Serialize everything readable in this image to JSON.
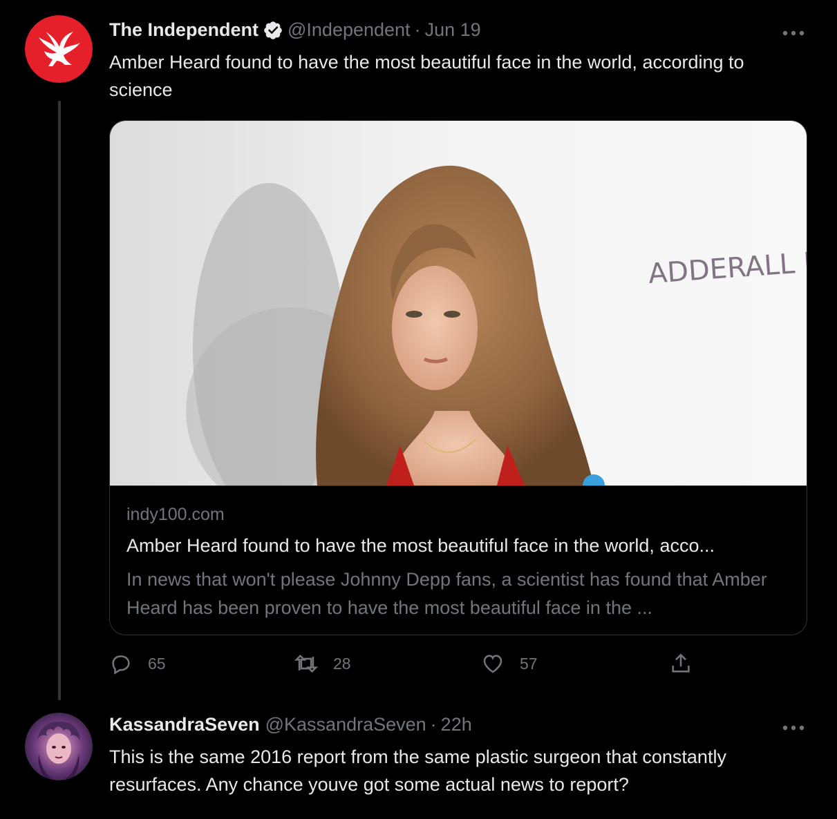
{
  "tweet": {
    "author": "The Independent",
    "handle": "@Independent",
    "separator": "·",
    "time": "Jun 19",
    "text": "Amber Heard found to have the most beautiful face in the world, according to science",
    "card": {
      "domain": "indy100.com",
      "title": "Amber Heard found to have the most beautiful face in the world, acco...",
      "description": "In news that won't please Johnny Depp fans, a scientist has found that Amber Heard has been proven to have the most beautiful face in the ...",
      "image_sign_text": "ADDERALL DIARIES"
    },
    "stats": {
      "replies": "65",
      "retweets": "28",
      "likes": "57"
    }
  },
  "reply": {
    "author": "KassandraSeven",
    "handle": "@KassandraSeven",
    "separator": "·",
    "time": "22h",
    "text": "This is the same 2016 report from the same plastic surgeon that constantly resurfaces. Any chance youve got some actual news to report?"
  },
  "colors": {
    "background": "#000000",
    "primary_text": "#e7e9ea",
    "secondary_text": "#71767b",
    "independent_red": "#e5202b",
    "verified_blue": "#1d9bf0"
  },
  "icons": [
    "verified-icon",
    "more-icon",
    "reply-icon",
    "retweet-icon",
    "like-icon",
    "share-icon"
  ]
}
